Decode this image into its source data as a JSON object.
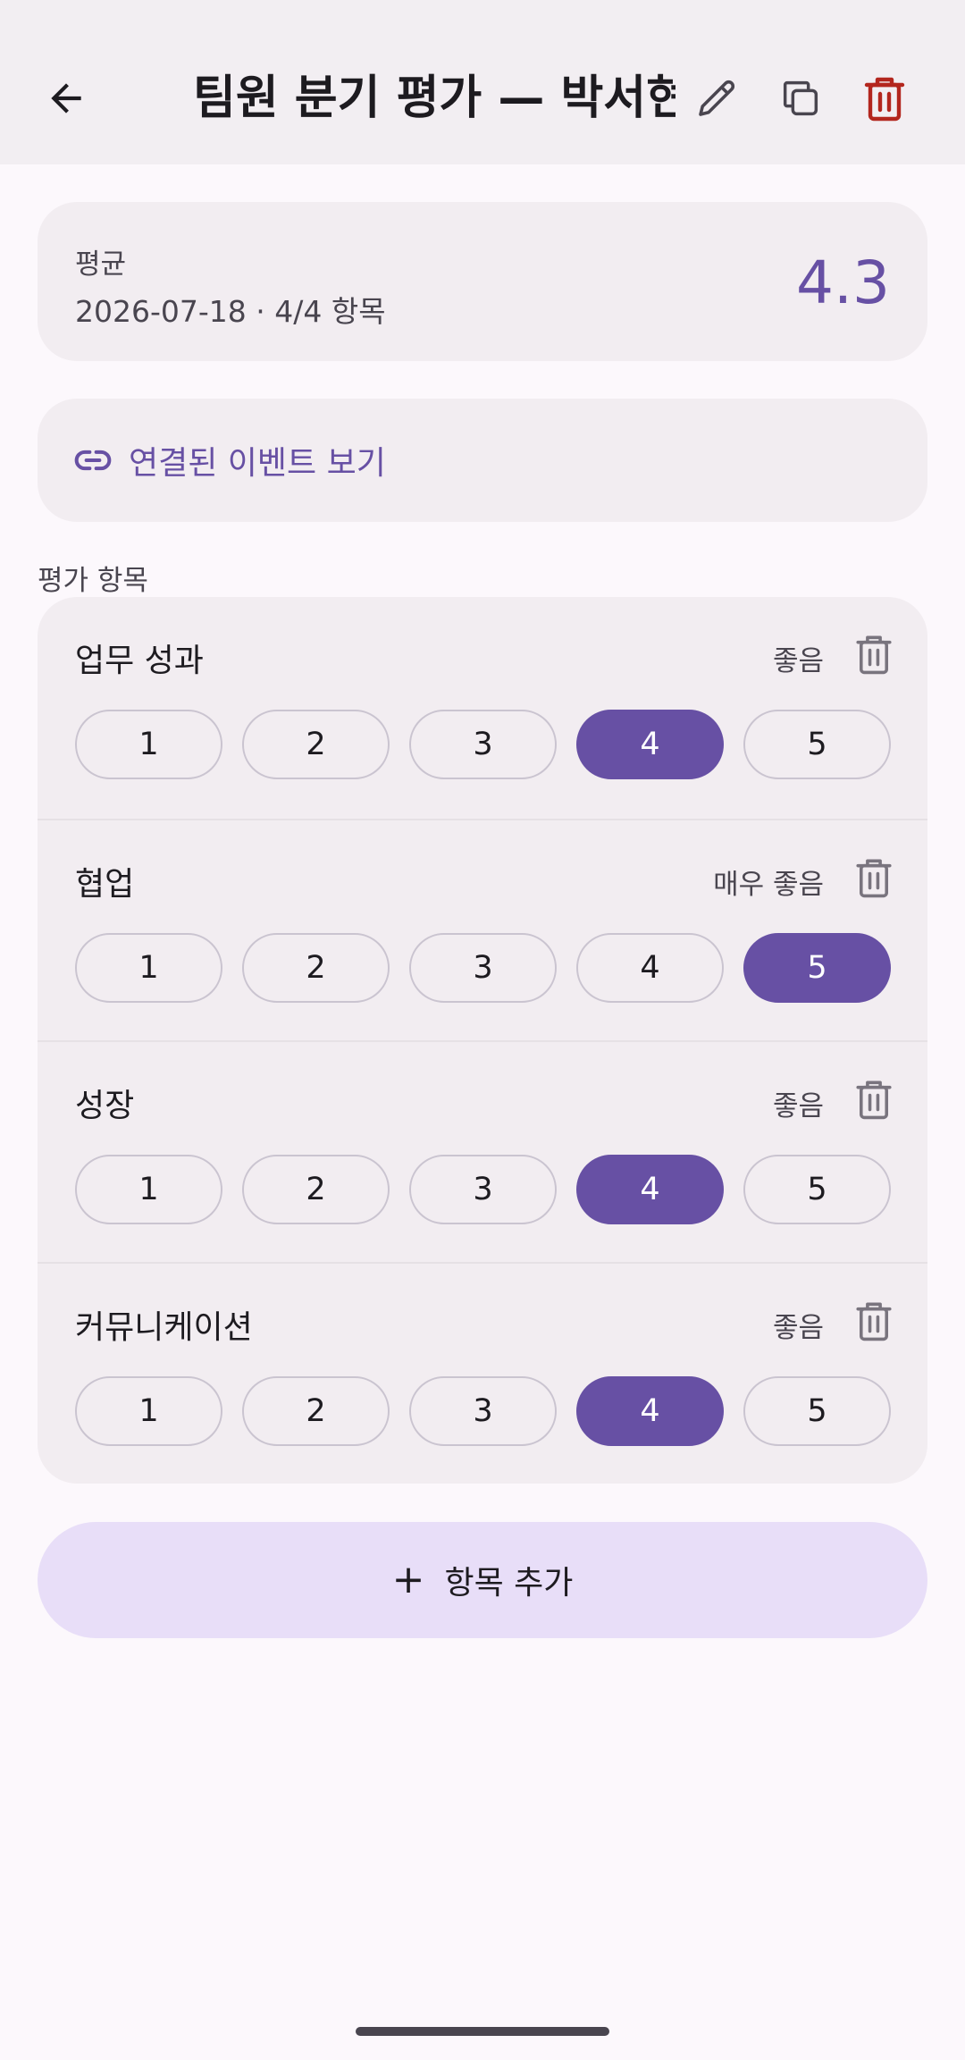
{
  "header": {
    "title": "팀원 분기 평가 — 박서현",
    "back_icon": "arrow-back-icon",
    "edit_icon": "pencil-icon",
    "copy_icon": "copy-icon",
    "delete_icon": "trash-icon",
    "delete_color": "#b3261e"
  },
  "summary": {
    "label": "평균",
    "meta": "2026-07-18 · 4/4 항목",
    "average": "4.3"
  },
  "linked_event": {
    "icon": "link-icon",
    "label": "연결된 이벤트 보기"
  },
  "section_label": "평가 항목",
  "items": [
    {
      "name": "업무 성과",
      "rating_text": "좋음",
      "scale": [
        "1",
        "2",
        "3",
        "4",
        "5"
      ],
      "selected": 4
    },
    {
      "name": "협업",
      "rating_text": "매우 좋음",
      "scale": [
        "1",
        "2",
        "3",
        "4",
        "5"
      ],
      "selected": 5
    },
    {
      "name": "성장",
      "rating_text": "좋음",
      "scale": [
        "1",
        "2",
        "3",
        "4",
        "5"
      ],
      "selected": 4
    },
    {
      "name": "커뮤니케이션",
      "rating_text": "좋음",
      "scale": [
        "1",
        "2",
        "3",
        "4",
        "5"
      ],
      "selected": 4
    }
  ],
  "add_button": {
    "plus": "+",
    "label": "항목 추가"
  },
  "colors": {
    "accent": "#6750a4",
    "add_button_bg": "#e8def8",
    "card_bg": "#f2edf1",
    "background": "#fcf8fc"
  }
}
